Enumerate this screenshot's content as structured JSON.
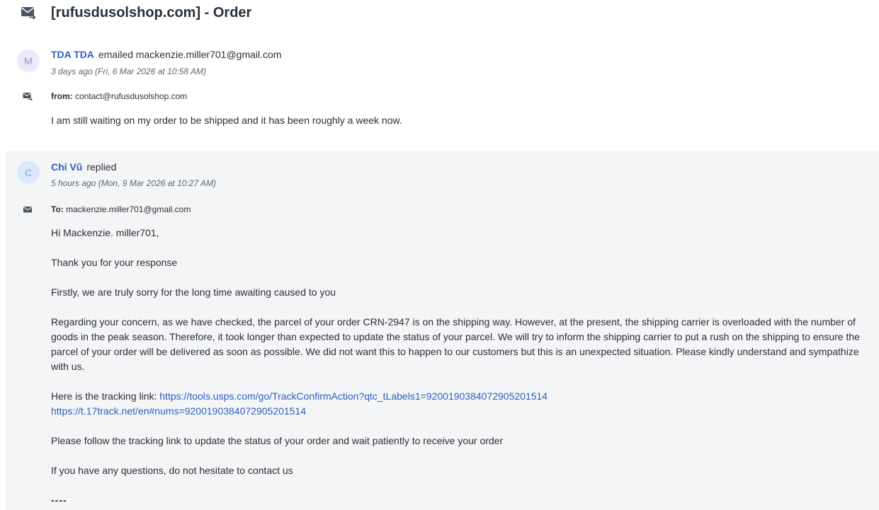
{
  "title": "[rufusdusolshop.com] - Order",
  "messages": [
    {
      "avatar_letter": "M",
      "sender_name": "TDA TDA",
      "action": "emailed mackenzie.miller701@gmail.com",
      "timestamp": "3 days ago (Fri, 6 Mar 2026 at 10:58 AM)",
      "addr_label": "from:",
      "addr_value": "contact@rufusdusolshop.com",
      "body": "I am still waiting on my order to be shipped and it has been roughly a week now."
    },
    {
      "avatar_letter": "C",
      "sender_name": "Chi Vũ",
      "action": "replied",
      "timestamp": "5 hours ago (Mon, 9 Mar 2026 at 10:27 AM)",
      "addr_label": "To:",
      "addr_value": "mackenzie.miller701@gmail.com",
      "greeting": "Hi Mackenzie. miller701,",
      "thanks": "Thank you for your response",
      "apology": "Firstly, we are truly sorry for the long time awaiting caused to you",
      "concern": "Regarding your concern, as we have checked, the parcel of your order CRN-2947 is on the shipping way. However, at the present, the shipping carrier is overloaded with the number of goods in the peak season. Therefore, it took longer than expected to update the status of your parcel. We will try to inform the shipping carrier to put a rush on the shipping to ensure the parcel of your order will be delivered as soon as possible. We did not want this to happen to our customers but this is an unexpected situation. Please kindly understand and sympathize with us.",
      "tracking_intro": "Here is the tracking link:",
      "tracking_link_1": "https://tools.usps.com/go/TrackConfirmAction?qtc_tLabels1=9200190384072905201514",
      "tracking_link_2": "https://t.17track.net/en#nums=9200190384072905201514",
      "follow": "Please follow the tracking link to update the status of your order and wait patiently to receive your order",
      "questions": "If you have any questions, do not hesitate to contact us",
      "signature": "----"
    }
  ],
  "icons": {
    "header": "mail-forward-icon",
    "from": "mail-forward-icon",
    "to": "mail-icon"
  },
  "colors": {
    "link": "#2c5fbf",
    "reply_bg": "#f4f5f7"
  }
}
